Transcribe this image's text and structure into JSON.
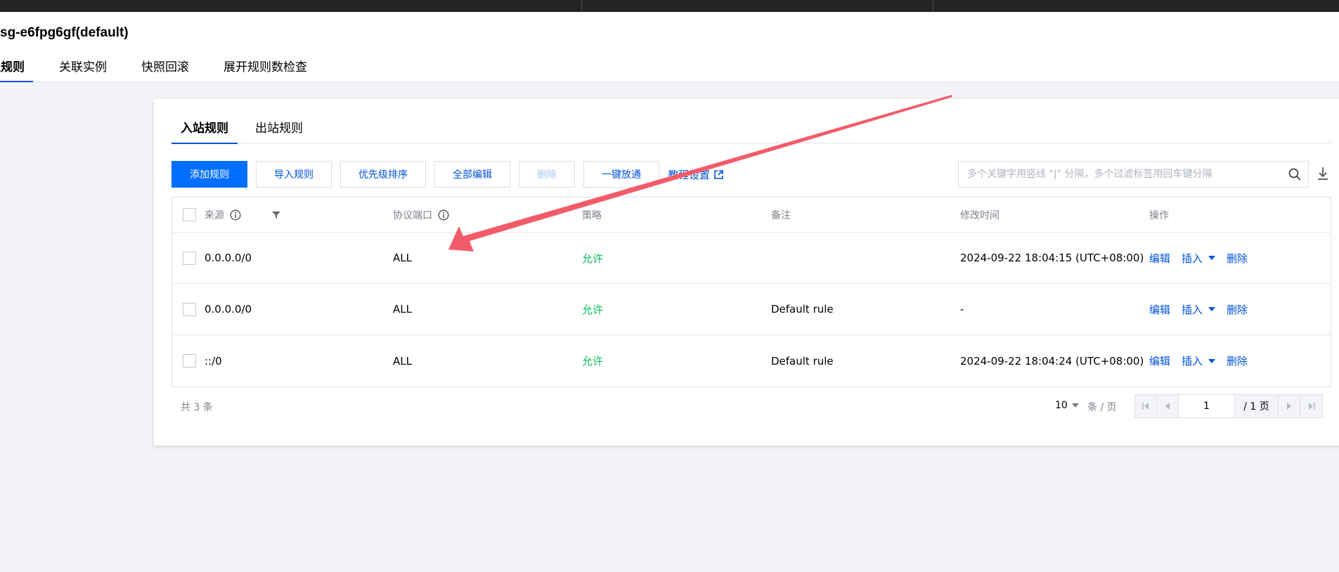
{
  "header": {
    "title": "sg-e6fpg6gf(default)",
    "tabs": [
      "组规则",
      "关联实例",
      "快照回滚",
      "展开规则数检查"
    ]
  },
  "rule_tabs": [
    "入站规则",
    "出站规则"
  ],
  "toolbar": {
    "add": "添加规则",
    "import": "导入规则",
    "priority": "优先级排序",
    "edit_all": "全部编辑",
    "delete": "删除",
    "one_click": "一键放通",
    "tutorial": "教程设置"
  },
  "search": {
    "placeholder": "多个关键字用竖线 \"|\" 分隔，多个过滤标签用回车键分隔"
  },
  "table": {
    "headers": [
      "来源",
      "协议端口",
      "策略",
      "备注",
      "修改时间",
      "操作"
    ],
    "rows": [
      {
        "source": "0.0.0.0/0",
        "port": "ALL",
        "policy": "允许",
        "note": "",
        "time": "2024-09-22 18:04:15 (UTC+08:00)"
      },
      {
        "source": "0.0.0.0/0",
        "port": "ALL",
        "policy": "允许",
        "note": "Default rule",
        "time": "-"
      },
      {
        "source": "::/0",
        "port": "ALL",
        "policy": "允许",
        "note": "Default rule",
        "time": "2024-09-22 18:04:24 (UTC+08:00)"
      }
    ],
    "ops": {
      "edit": "编辑",
      "insert": "插入",
      "delete": "删除"
    }
  },
  "footer": {
    "total": "共 3 条",
    "page_size": "10",
    "per_page": "条 / 页",
    "page": "1",
    "page_total": "/ 1 页"
  },
  "colors": {
    "primary": "#006eff",
    "link": "#0052d9",
    "allow": "#0abf5b",
    "annotation_arrow": "#f25c6a"
  }
}
